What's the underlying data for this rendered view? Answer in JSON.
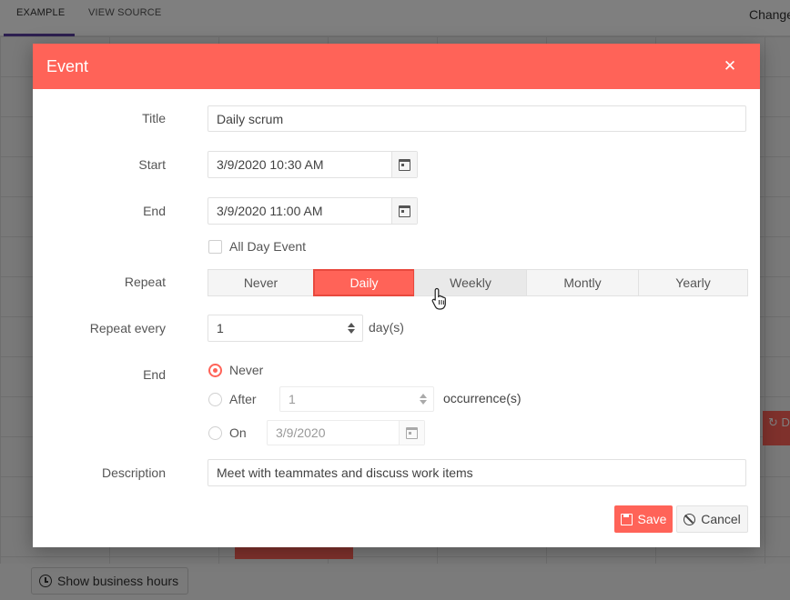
{
  "background": {
    "tabs": [
      {
        "label": "EXAMPLE"
      },
      {
        "label": "VIEW SOURCE"
      }
    ],
    "change_label": "Change",
    "side_button_label": "D",
    "business_hours_label": "Show business hours"
  },
  "dialog": {
    "title": "Event",
    "close_icon": "close-icon",
    "title_label": "Title",
    "title_value": "Daily scrum",
    "start_label": "Start",
    "start_value": "3/9/2020 10:30 AM",
    "end_label": "End",
    "end_value": "3/9/2020 11:00 AM",
    "all_day_label": "All Day Event",
    "all_day_checked": false,
    "repeat_label": "Repeat",
    "repeat_options": [
      {
        "label": "Never"
      },
      {
        "label": "Daily"
      },
      {
        "label": "Weekly"
      },
      {
        "label": "Montly"
      },
      {
        "label": "Yearly"
      }
    ],
    "repeat_selected": "Daily",
    "repeat_every_label": "Repeat every",
    "repeat_every_value": "1",
    "repeat_every_unit": "day(s)",
    "end_rule_label": "End",
    "end_never_label": "Never",
    "end_after_label": "After",
    "end_after_value": "1",
    "end_after_unit": "occurrence(s)",
    "end_on_label": "On",
    "end_on_value": "3/9/2020",
    "end_selected": "Never",
    "description_label": "Description",
    "description_value": "Meet with teammates and discuss work items",
    "save_label": "Save",
    "cancel_label": "Cancel"
  },
  "colors": {
    "accent": "#ff6358",
    "accent_border": "#e8493e",
    "overlay": "rgba(0,0,0,0.5)"
  }
}
